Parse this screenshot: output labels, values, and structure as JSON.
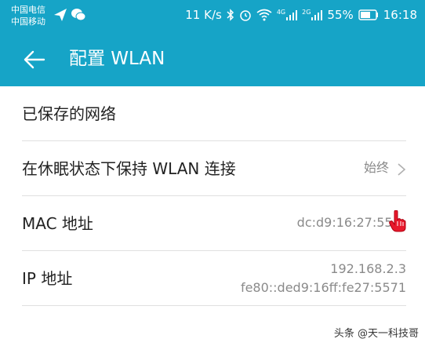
{
  "status_bar": {
    "carrier_1": "中国电信",
    "carrier_2": "中国移动",
    "network_speed": "11 K/s",
    "signal_4g": "4G",
    "signal_2g": "2G",
    "battery": "55%",
    "time": "16:18"
  },
  "app_bar": {
    "title": "配置 WLAN"
  },
  "rows": [
    {
      "label": "已保存的网络"
    },
    {
      "label": "在休眠状态下保持 WLAN 连接",
      "value": "始终"
    },
    {
      "label": "MAC 地址",
      "value": "dc:d9:16:27:55:"
    },
    {
      "label": "IP 地址",
      "value_line1": "192.168.2.3",
      "value_line2": "fe80::ded9:16ff:fe27:5571"
    }
  ],
  "watermark": "头条 @天一科技哥",
  "colors": {
    "accent": "#16a4c7",
    "divider": "#e0e0e0",
    "secondary_text": "#8a8a8a"
  }
}
